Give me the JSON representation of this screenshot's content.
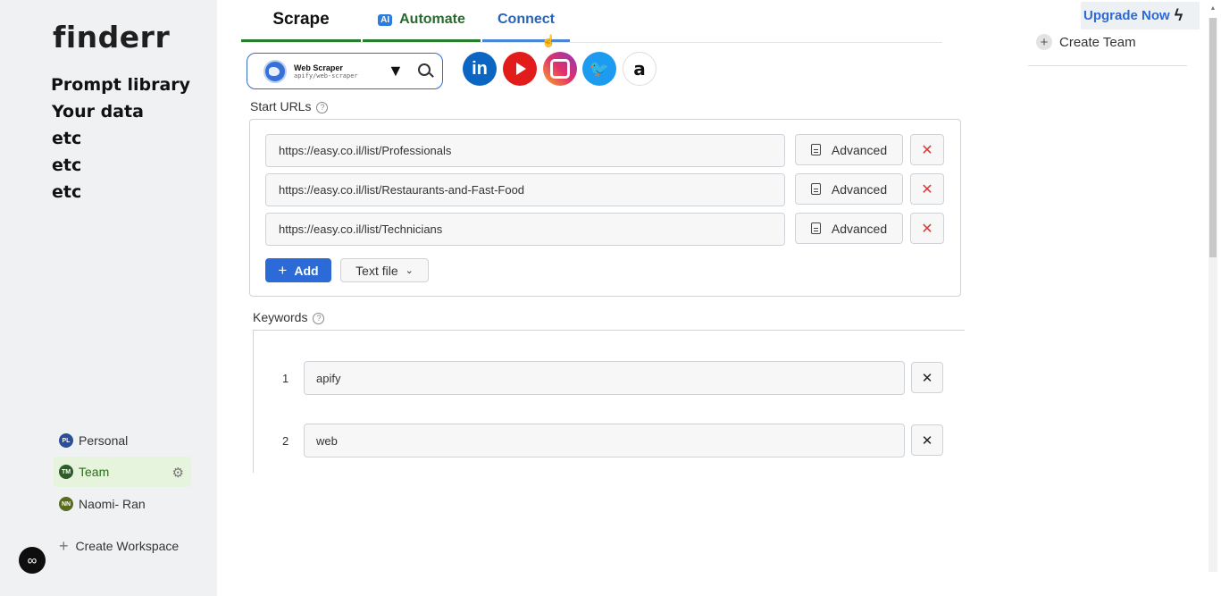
{
  "sidebar": {
    "brand": "finderr",
    "nav": [
      "Prompt library",
      "Your data",
      "etc",
      "etc",
      "etc"
    ],
    "workspaces": [
      {
        "initials": "PL",
        "name": "Personal",
        "color": "#2a4e9a"
      },
      {
        "initials": "TM",
        "name": "Team",
        "color": "#2f5a2a"
      },
      {
        "initials": "NN",
        "name": "Naomi- Ran",
        "color": "#5a6a1f"
      }
    ],
    "create_workspace": "Create Workspace"
  },
  "tabs": {
    "scrape": "Scrape",
    "ai_badge": "AI",
    "automate": "Automate",
    "connect": "Connect"
  },
  "actor": {
    "title": "Web Scraper",
    "slug": "apify/web-scraper"
  },
  "social_icons": [
    "linkedin-icon",
    "youtube-icon",
    "instagram-icon",
    "twitter-icon",
    "amazon-icon"
  ],
  "start_urls": {
    "label": "Start URLs",
    "urls": [
      "https://easy.co.il/list/Professionals",
      "https://easy.co.il/list/Restaurants-and-Fast-Food",
      "https://easy.co.il/list/Technicians"
    ],
    "advanced_label": "Advanced",
    "add_label": "Add",
    "textfile_label": "Text file"
  },
  "keywords": {
    "label": "Keywords",
    "items": [
      {
        "num": "1",
        "value": "apify"
      },
      {
        "num": "2",
        "value": "web"
      }
    ]
  },
  "right": {
    "upgrade": "Upgrade Now",
    "create_team": "Create Team"
  }
}
